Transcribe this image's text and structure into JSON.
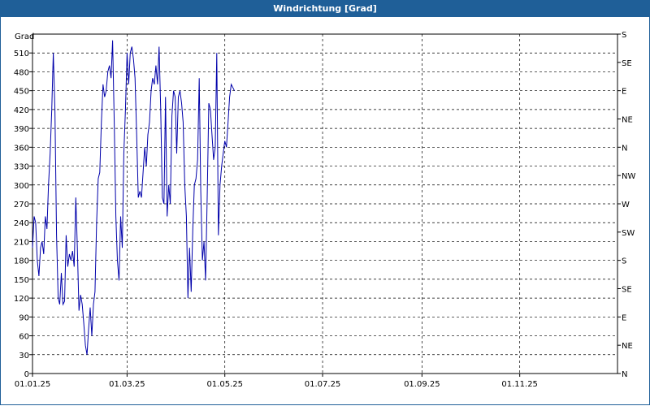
{
  "window": {
    "title": "Windrichtung [Grad]"
  },
  "chart_data": {
    "type": "line",
    "title": "Windrichtung [Grad]",
    "ylabel": "Grad",
    "ylim": [
      0,
      540
    ],
    "yticks": [
      0,
      30,
      60,
      90,
      120,
      150,
      180,
      210,
      240,
      270,
      300,
      330,
      360,
      390,
      420,
      450,
      480,
      510
    ],
    "right_axis_labels": [
      {
        "v": 0,
        "label": "N"
      },
      {
        "v": 45,
        "label": "NE"
      },
      {
        "v": 90,
        "label": "E"
      },
      {
        "v": 135,
        "label": "SE"
      },
      {
        "v": 180,
        "label": "S"
      },
      {
        "v": 225,
        "label": "SW"
      },
      {
        "v": 270,
        "label": "W"
      },
      {
        "v": 315,
        "label": "NW"
      },
      {
        "v": 360,
        "label": "N"
      },
      {
        "v": 405,
        "label": "NE"
      },
      {
        "v": 450,
        "label": "E"
      },
      {
        "v": 495,
        "label": "SE"
      },
      {
        "v": 540,
        "label": "S"
      }
    ],
    "xlim": [
      "2025-01-01",
      "2026-01-01"
    ],
    "xticks": [
      "01.01.25",
      "01.03.25",
      "01.05.25",
      "01.07.25",
      "01.09.25",
      "01.11.25"
    ],
    "grid": true,
    "line_color": "#0000aa",
    "series": [
      {
        "values": [
          [
            0,
            200
          ],
          [
            1,
            250
          ],
          [
            2,
            240
          ],
          [
            3,
            180
          ],
          [
            4,
            155
          ],
          [
            5,
            200
          ],
          [
            6,
            210
          ],
          [
            7,
            190
          ],
          [
            8,
            250
          ],
          [
            9,
            230
          ],
          [
            10,
            300
          ],
          [
            11,
            350
          ],
          [
            12,
            420
          ],
          [
            13,
            510
          ],
          [
            14,
            420
          ],
          [
            15,
            220
          ],
          [
            16,
            120
          ],
          [
            17,
            110
          ],
          [
            18,
            160
          ],
          [
            19,
            110
          ],
          [
            20,
            115
          ],
          [
            21,
            220
          ],
          [
            22,
            170
          ],
          [
            23,
            190
          ],
          [
            24,
            180
          ],
          [
            25,
            195
          ],
          [
            26,
            170
          ],
          [
            27,
            280
          ],
          [
            28,
            200
          ],
          [
            29,
            100
          ],
          [
            30,
            125
          ],
          [
            31,
            110
          ],
          [
            32,
            80
          ],
          [
            33,
            45
          ],
          [
            34,
            30
          ],
          [
            35,
            70
          ],
          [
            36,
            105
          ],
          [
            37,
            60
          ],
          [
            38,
            110
          ],
          [
            39,
            130
          ],
          [
            40,
            240
          ],
          [
            41,
            310
          ],
          [
            42,
            320
          ],
          [
            43,
            400
          ],
          [
            44,
            460
          ],
          [
            45,
            440
          ],
          [
            46,
            450
          ],
          [
            47,
            480
          ],
          [
            48,
            490
          ],
          [
            49,
            470
          ],
          [
            50,
            530
          ],
          [
            51,
            400
          ],
          [
            52,
            250
          ],
          [
            53,
            180
          ],
          [
            54,
            148
          ],
          [
            55,
            250
          ],
          [
            56,
            200
          ],
          [
            57,
            350
          ],
          [
            58,
            420
          ],
          [
            59,
            510
          ],
          [
            60,
            460
          ],
          [
            61,
            510
          ],
          [
            62,
            520
          ],
          [
            63,
            500
          ],
          [
            64,
            470
          ],
          [
            65,
            380
          ],
          [
            66,
            280
          ],
          [
            67,
            290
          ],
          [
            68,
            280
          ],
          [
            69,
            320
          ],
          [
            70,
            360
          ],
          [
            71,
            330
          ],
          [
            72,
            380
          ],
          [
            73,
            400
          ],
          [
            74,
            450
          ],
          [
            75,
            470
          ],
          [
            76,
            460
          ],
          [
            77,
            490
          ],
          [
            78,
            460
          ],
          [
            79,
            520
          ],
          [
            80,
            420
          ],
          [
            81,
            280
          ],
          [
            82,
            270
          ],
          [
            83,
            440
          ],
          [
            84,
            250
          ],
          [
            85,
            300
          ],
          [
            86,
            270
          ],
          [
            87,
            410
          ],
          [
            88,
            450
          ],
          [
            89,
            440
          ],
          [
            90,
            350
          ],
          [
            91,
            440
          ],
          [
            92,
            450
          ],
          [
            93,
            430
          ],
          [
            94,
            400
          ],
          [
            95,
            300
          ],
          [
            96,
            250
          ],
          [
            97,
            120
          ],
          [
            98,
            200
          ],
          [
            99,
            130
          ],
          [
            100,
            230
          ],
          [
            101,
            300
          ],
          [
            102,
            310
          ],
          [
            103,
            340
          ],
          [
            104,
            470
          ],
          [
            105,
            290
          ],
          [
            106,
            180
          ],
          [
            107,
            210
          ],
          [
            108,
            148
          ],
          [
            109,
            280
          ],
          [
            110,
            430
          ],
          [
            111,
            420
          ],
          [
            112,
            380
          ],
          [
            113,
            340
          ],
          [
            114,
            360
          ],
          [
            115,
            510
          ],
          [
            116,
            220
          ],
          [
            117,
            300
          ],
          [
            118,
            330
          ],
          [
            119,
            350
          ],
          [
            120,
            370
          ],
          [
            121,
            360
          ],
          [
            122,
            400
          ],
          [
            123,
            440
          ],
          [
            124,
            460
          ],
          [
            125,
            455
          ],
          [
            126,
            450
          ]
        ]
      }
    ]
  }
}
